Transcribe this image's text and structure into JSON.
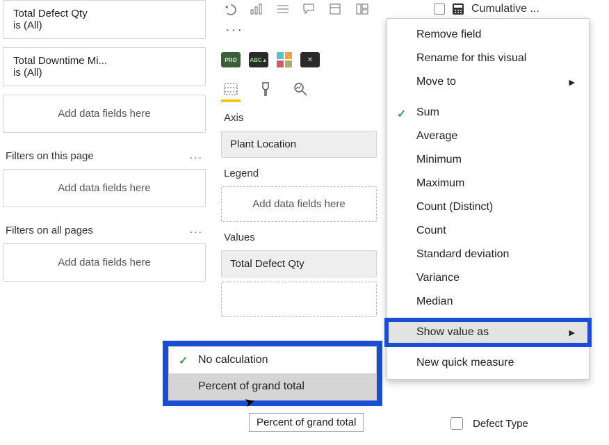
{
  "filters": {
    "visual": [
      {
        "name": "Total Defect Qty",
        "state": "is (All)"
      },
      {
        "name": "Total Downtime Mi...",
        "state": "is (All)"
      }
    ],
    "page_header": "Filters on this page",
    "all_header": "Filters on all pages",
    "add_placeholder": "Add data fields here"
  },
  "viz": {
    "axis_label": "Axis",
    "axis_value": "Plant Location",
    "legend_label": "Legend",
    "legend_placeholder": "Add data fields here",
    "values_label": "Values",
    "values_value": "Total Defect Qty"
  },
  "rightHeader": {
    "label": "Cumulative ..."
  },
  "contextMenu": {
    "items": [
      {
        "label": "Remove field",
        "arrow": false
      },
      {
        "label": "Rename for this visual",
        "arrow": false
      },
      {
        "label": "Move to",
        "arrow": true
      }
    ],
    "aggItems": [
      {
        "label": "Sum",
        "checked": true
      },
      {
        "label": "Average"
      },
      {
        "label": "Minimum"
      },
      {
        "label": "Maximum"
      },
      {
        "label": "Count (Distinct)"
      },
      {
        "label": "Count"
      },
      {
        "label": "Standard deviation"
      },
      {
        "label": "Variance"
      },
      {
        "label": "Median"
      }
    ],
    "showValueAs": "Show value as",
    "newMeasure": "New quick measure"
  },
  "submenu": {
    "noCalc": "No calculation",
    "pct": "Percent of grand total",
    "tooltip": "Percent of grand total"
  },
  "fieldList": {
    "defectType": "Defect Type"
  }
}
